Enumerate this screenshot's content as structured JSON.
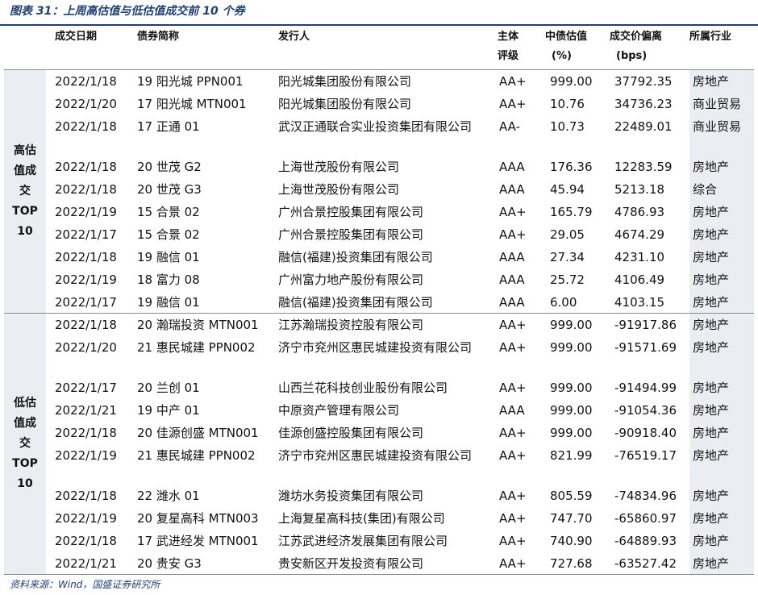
{
  "title": "图表 31：上周高估值与低估值成交前 10 个券",
  "headers": {
    "date": "成交日期",
    "bond": "债券简称",
    "issuer": "发行人",
    "rating_line1": "主体",
    "rating_line2": "评级",
    "valuation_line1": "中债估值",
    "valuation_line2": "(%)",
    "deviation_line1": "成交价偏离",
    "deviation_line2": "(bps)",
    "industry": "所属行业"
  },
  "sections": [
    {
      "label_lines": [
        "高估",
        "值成",
        "交",
        "TOP",
        "10"
      ],
      "rows": [
        {
          "date": "2022/1/18",
          "bond": "19 阳光城 PPN001",
          "issuer": "阳光城集团股份有限公司",
          "rating": "AA+",
          "valuation": "999.00",
          "deviation": "37792.35",
          "industry": "房地产"
        },
        {
          "date": "2022/1/20",
          "bond": "17 阳光城 MTN001",
          "issuer": "阳光城集团股份有限公司",
          "rating": "AA+",
          "valuation": "10.76",
          "deviation": "34736.23",
          "industry": "商业贸易"
        },
        {
          "date": "2022/1/18",
          "bond": "17 正通 01",
          "issuer": "武汉正通联合实业投资集团有限公司",
          "rating": "AA-",
          "valuation": "10.73",
          "deviation": "22489.01",
          "industry": "商业贸易"
        },
        {
          "date": "2022/1/18",
          "bond": "20 世茂 G2",
          "issuer": "上海世茂股份有限公司",
          "rating": "AAA",
          "valuation": "176.36",
          "deviation": "12283.59",
          "industry": "房地产"
        },
        {
          "date": "2022/1/18",
          "bond": "20 世茂 G3",
          "issuer": "上海世茂股份有限公司",
          "rating": "AAA",
          "valuation": "45.94",
          "deviation": "5213.18",
          "industry": "综合"
        },
        {
          "date": "2022/1/19",
          "bond": "15 合景 02",
          "issuer": "广州合景控股集团有限公司",
          "rating": "AA+",
          "valuation": "165.79",
          "deviation": "4786.93",
          "industry": "房地产"
        },
        {
          "date": "2022/1/17",
          "bond": "15 合景 02",
          "issuer": "广州合景控股集团有限公司",
          "rating": "AA+",
          "valuation": "29.05",
          "deviation": "4674.29",
          "industry": "房地产"
        },
        {
          "date": "2022/1/18",
          "bond": "19 融信 01",
          "issuer": "融信(福建)投资集团有限公司",
          "rating": "AAA",
          "valuation": "27.34",
          "deviation": "4231.10",
          "industry": "房地产"
        },
        {
          "date": "2022/1/19",
          "bond": "18 富力 08",
          "issuer": "广州富力地产股份有限公司",
          "rating": "AAA",
          "valuation": "25.72",
          "deviation": "4106.49",
          "industry": "房地产"
        },
        {
          "date": "2022/1/17",
          "bond": "19 融信 01",
          "issuer": "融信(福建)投资集团有限公司",
          "rating": "AAA",
          "valuation": "6.00",
          "deviation": "4103.15",
          "industry": "房地产"
        }
      ]
    },
    {
      "label_lines": [
        "低估",
        "值成",
        "交",
        "TOP",
        "10"
      ],
      "rows": [
        {
          "date": "2022/1/18",
          "bond": "20 瀚瑞投资 MTN001",
          "issuer": "江苏瀚瑞投资控股有限公司",
          "rating": "AA+",
          "valuation": "999.00",
          "deviation": "-91917.86",
          "industry": "房地产"
        },
        {
          "date": "2022/1/20",
          "bond": "21 惠民城建 PPN002",
          "issuer": "济宁市兖州区惠民城建投资有限公司",
          "rating": "AA+",
          "valuation": "999.00",
          "deviation": "-91571.69",
          "industry": "房地产"
        },
        {
          "date": "2022/1/17",
          "bond": "20 兰创 01",
          "issuer": "山西兰花科技创业股份有限公司",
          "rating": "AA+",
          "valuation": "999.00",
          "deviation": "-91494.99",
          "industry": "房地产"
        },
        {
          "date": "2022/1/21",
          "bond": "19 中产 01",
          "issuer": "中原资产管理有限公司",
          "rating": "AAA",
          "valuation": "999.00",
          "deviation": "-91054.36",
          "industry": "房地产"
        },
        {
          "date": "2022/1/18",
          "bond": "20 佳源创盛 MTN001",
          "issuer": "佳源创盛控股集团有限公司",
          "rating": "AA+",
          "valuation": "999.00",
          "deviation": "-90918.40",
          "industry": "房地产"
        },
        {
          "date": "2022/1/19",
          "bond": "21 惠民城建 PPN002",
          "issuer": "济宁市兖州区惠民城建投资有限公司",
          "rating": "AA+",
          "valuation": "821.99",
          "deviation": "-76519.17",
          "industry": "房地产"
        },
        {
          "date": "2022/1/18",
          "bond": "22 潍水 01",
          "issuer": "潍坊水务投资集团有限公司",
          "rating": "AA+",
          "valuation": "805.59",
          "deviation": "-74834.96",
          "industry": "房地产"
        },
        {
          "date": "2022/1/19",
          "bond": "20 复星高科 MTN003",
          "issuer": "上海复星高科技(集团)有限公司",
          "rating": "AA+",
          "valuation": "747.70",
          "deviation": "-65860.97",
          "industry": "房地产"
        },
        {
          "date": "2022/1/18",
          "bond": "17 武进经发 MTN001",
          "issuer": "江苏武进经济发展集团有限公司",
          "rating": "AA+",
          "valuation": "740.90",
          "deviation": "-64889.93",
          "industry": "房地产"
        },
        {
          "date": "2022/1/21",
          "bond": "20 贵安 G3",
          "issuer": "贵安新区开发投资有限公司",
          "rating": "AA+",
          "valuation": "727.68",
          "deviation": "-63527.42",
          "industry": "房地产"
        }
      ]
    }
  ],
  "footer": "资料来源：Wind，国盛证券研究所",
  "colors": {
    "title": "#1f3f78",
    "shade": "#ecedf3",
    "rule": "#8a8a8a"
  }
}
